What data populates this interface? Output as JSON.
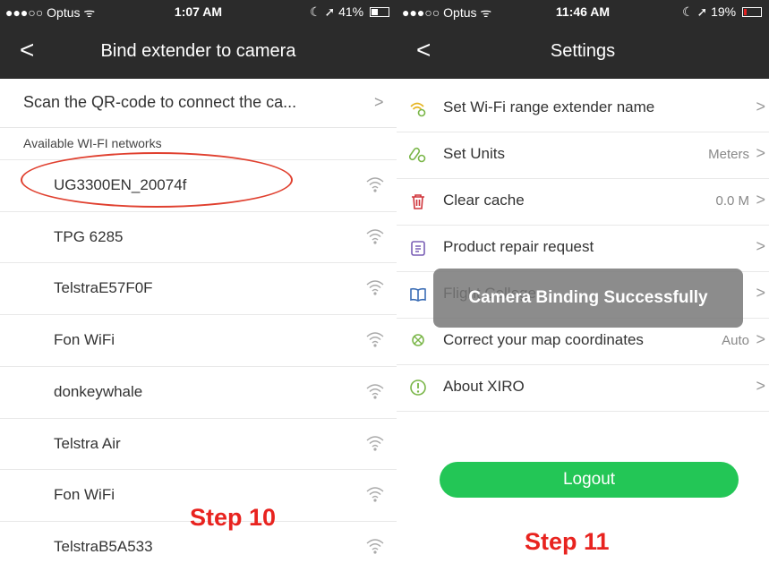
{
  "left": {
    "status": {
      "carrier": "●●●○○ Optus ᯤ",
      "time": "1:07 AM",
      "indicators": "☾ ➚ 41%",
      "battery_level": 0.41
    },
    "nav": {
      "back": "<",
      "title": "Bind extender to camera"
    },
    "qr_row": {
      "label": "Scan the QR-code to connect the ca...",
      "chevron": ">"
    },
    "section_header": "Available WI-FI networks",
    "networks": [
      {
        "name": "UG3300EN_20074f"
      },
      {
        "name": "TPG 6285"
      },
      {
        "name": "TelstraE57F0F"
      },
      {
        "name": "Fon WiFi"
      },
      {
        "name": "donkeywhale"
      },
      {
        "name": "Telstra Air"
      },
      {
        "name": "Fon WiFi"
      },
      {
        "name": "TelstraB5A533"
      }
    ],
    "step_label": "Step 10"
  },
  "right": {
    "status": {
      "carrier": "●●●○○ Optus ᯤ",
      "time": "11:46 AM",
      "indicators": "☾ ➚ 19%",
      "battery_level": 0.19
    },
    "nav": {
      "back": "<",
      "title": "Settings"
    },
    "settings": [
      {
        "icon": "wifi-extender-icon",
        "label": "Set Wi-Fi range extender name",
        "value": "",
        "chevron": ">"
      },
      {
        "icon": "units-icon",
        "label": "Set Units",
        "value": "Meters",
        "chevron": ">"
      },
      {
        "icon": "trash-icon",
        "label": "Clear cache",
        "value": "0.0 M",
        "chevron": ">"
      },
      {
        "icon": "repair-icon",
        "label": "Product repair request",
        "value": "",
        "chevron": ">"
      },
      {
        "icon": "book-icon",
        "label": "Flight College",
        "value": "",
        "chevron": ">"
      },
      {
        "icon": "map-icon",
        "label": "Correct your map coordinates",
        "value": "Auto",
        "chevron": ">"
      },
      {
        "icon": "info-icon",
        "label": "About XIRO",
        "value": "",
        "chevron": ">"
      }
    ],
    "toast": "Camera Binding Successfully",
    "logout_label": "Logout",
    "step_label": "Step 11"
  },
  "colors": {
    "accent_green": "#23c656",
    "step_red": "#e8231f",
    "icon_green": "#7ab648",
    "icon_red": "#d0343a",
    "icon_purple": "#7a5fb5",
    "icon_blue": "#3b6db5"
  }
}
